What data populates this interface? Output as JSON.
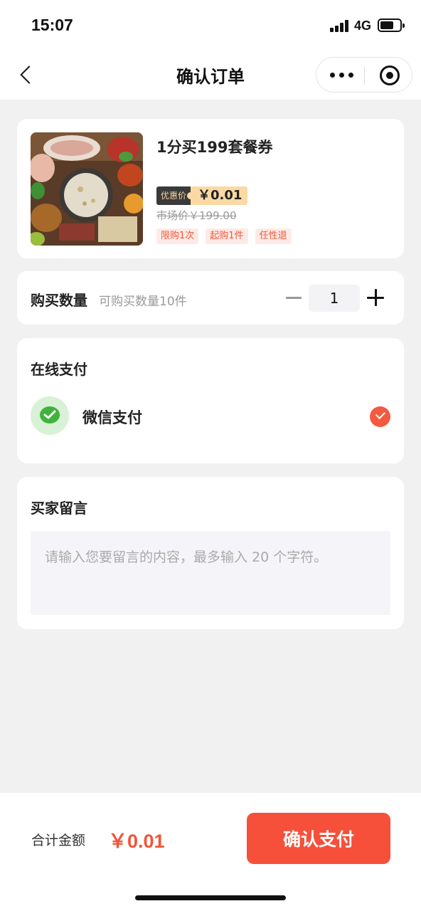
{
  "status": {
    "time": "15:07",
    "network": "4G",
    "battery_level": 0.7
  },
  "nav": {
    "title": "确认订单"
  },
  "product": {
    "name": "1分买199套餐券",
    "price_tag": "优惠价",
    "price": "￥0.01",
    "market_price": "市场价￥199.00",
    "tags": [
      "限购1次",
      "起购1件",
      "任性退"
    ]
  },
  "quantity": {
    "label": "购买数量",
    "hint": "可购买数量10件",
    "value": "1"
  },
  "payment": {
    "section_title": "在线支付",
    "method": "微信支付"
  },
  "message": {
    "section_title": "买家留言",
    "placeholder": "请输入您要留言的内容，最多输入 20 个字符。"
  },
  "footer": {
    "total_label": "合计金额",
    "total_amount": "￥0.01",
    "confirm_label": "确认支付"
  },
  "colors": {
    "accent": "#f6503a",
    "price_tag_bg": "#fbd9a5",
    "wechat_green": "#3fb33b"
  }
}
